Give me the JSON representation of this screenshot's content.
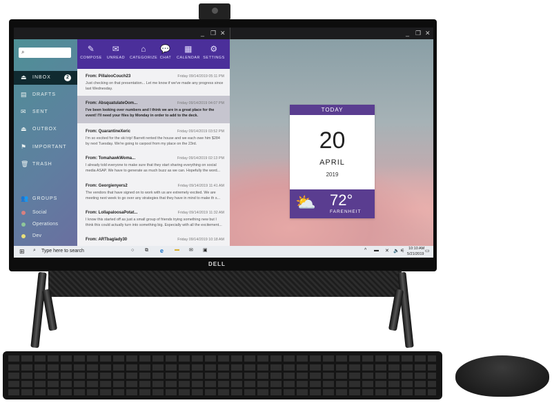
{
  "left_window": {
    "controls": [
      "_",
      "❐",
      "✕"
    ],
    "search": {
      "placeholder": ""
    },
    "sidebar": {
      "items": [
        {
          "label": "INBOX",
          "icon": "inbox-icon",
          "glyph": "⏏",
          "badge": "2"
        },
        {
          "label": "DRAFTS",
          "icon": "drafts-icon",
          "glyph": "▤"
        },
        {
          "label": "SENT",
          "icon": "sent-icon",
          "glyph": "✉"
        },
        {
          "label": "OUTBOX",
          "icon": "outbox-icon",
          "glyph": "⏏"
        },
        {
          "label": "IMPORTANT",
          "icon": "flag-icon",
          "glyph": "⚑"
        },
        {
          "label": "TRASH",
          "icon": "trash-icon",
          "glyph": "🗑"
        }
      ],
      "groups_label": "GROUPS",
      "groups": [
        {
          "label": "Social",
          "color": "#d98080"
        },
        {
          "label": "Operations",
          "color": "#8fc79a"
        },
        {
          "label": "Dev",
          "color": "#e8e07a"
        }
      ]
    },
    "toolbar": [
      {
        "label": "COMPOSE",
        "glyph": "✎"
      },
      {
        "label": "UNREAD",
        "glyph": "✉"
      },
      {
        "label": "CATEGORIZE",
        "glyph": "⌂"
      },
      {
        "label": "CHAT",
        "glyph": "💬"
      },
      {
        "label": "CALENDAR",
        "glyph": "▦"
      },
      {
        "label": "SETTINGS",
        "glyph": "⚙"
      }
    ],
    "emails": [
      {
        "from": "From: PillalooCouch23",
        "date": "Friday 09/14/2019 05:11 PM",
        "body": "Just checking on that presentation... Let me know if we've made any progress since last Wednesday."
      },
      {
        "from": "From: AbsquatulateOom...",
        "date": "Friday 09/14/2019 04:07 PM",
        "body": "I've been looking over numbers and I think we are in a great place for the event! I'll need your files by Monday in order to add to the deck."
      },
      {
        "from": "From: QuarantineXeric",
        "date": "Friday 09/14/2019 03:52 PM",
        "body": "I'm so excited for the ski trip! Barrett rented the house and we each owe him $284 by next Tuesday. We're going to carpool from my place on the 23rd."
      },
      {
        "from": "From: TomahawkWoma...",
        "date": "Friday 09/14/2019 02:13 PM",
        "body": "I already told everyone to make sure that they start sharing everything on social media ASAP. We have to generate as much buzz as we can. Hopefully the word..."
      },
      {
        "from": "From: Georgienyers2",
        "date": "Friday 09/14/2019 11:41 AM",
        "body": "The vendors that have signed on to work with us are extremely excited. We are meeting next week to go over any strategies that they have in mind to make th s..."
      },
      {
        "from": "From: LollapaloosaPotat...",
        "date": "Friday 09/14/2019 11:32 AM",
        "body": "I know this started off as just a small group of friends trying something new but I think this could actually turn into something big. Especially with all the excitement..."
      },
      {
        "from": "From: ARTbaglady30",
        "date": "Friday 09/14/2019 10:18 AM",
        "body": ""
      }
    ]
  },
  "right_window": {
    "controls": [
      "_",
      "❐",
      "✕"
    ],
    "widget": {
      "header": "TODAY",
      "day": "20",
      "month": "APRIL",
      "year": "2019",
      "temp": "72°",
      "unit": "FARENHEIT",
      "weather_icon": "partly-cloudy-icon"
    }
  },
  "taskbar": {
    "search_placeholder": "Type here to search",
    "time": "10:10 AM",
    "date": "5/21/2019"
  },
  "brand": "DELL"
}
